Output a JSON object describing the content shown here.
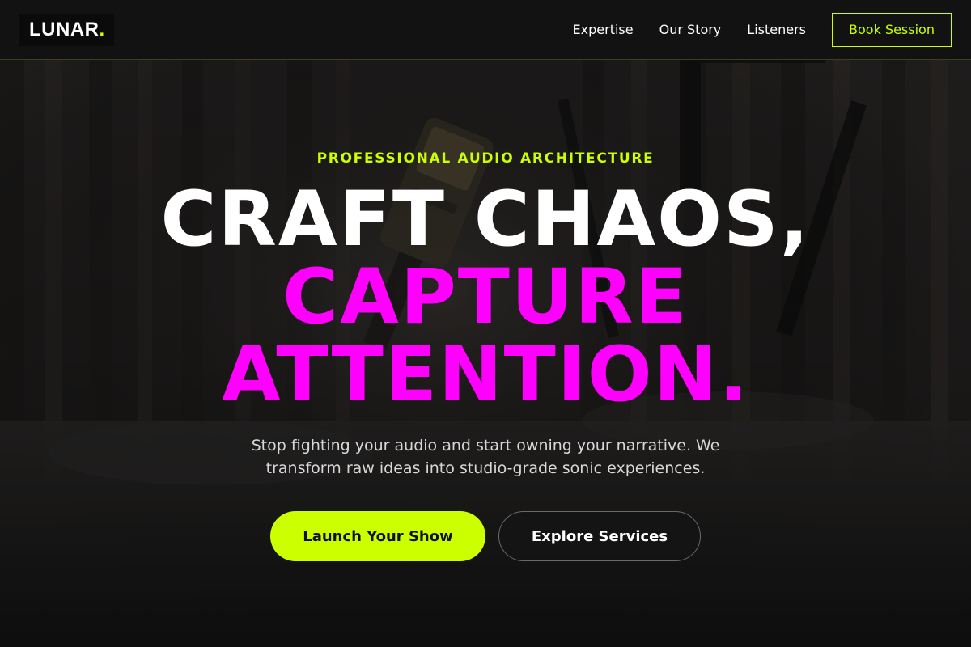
{
  "brand": {
    "name": "LUNAR",
    "dot": ".",
    "accent_color": "#ccff00",
    "highlight_color": "#ff00ff"
  },
  "nav": {
    "links": [
      "Expertise",
      "Our Story",
      "Listeners"
    ],
    "cta_label": "Book Session"
  },
  "hero": {
    "eyebrow": "PROFESSIONAL AUDIO ARCHITECTURE",
    "headline_line1": "CRAFT CHAOS,",
    "headline_line2": "CAPTURE",
    "headline_line3": "ATTENTION.",
    "subtext": "Stop fighting your audio and start owning your narrative. We transform raw ideas into studio-grade sonic experiences.",
    "primary_cta": "Launch Your Show",
    "secondary_cta": "Explore Services",
    "background_image": "dimmed-studio-microphone-photo"
  }
}
